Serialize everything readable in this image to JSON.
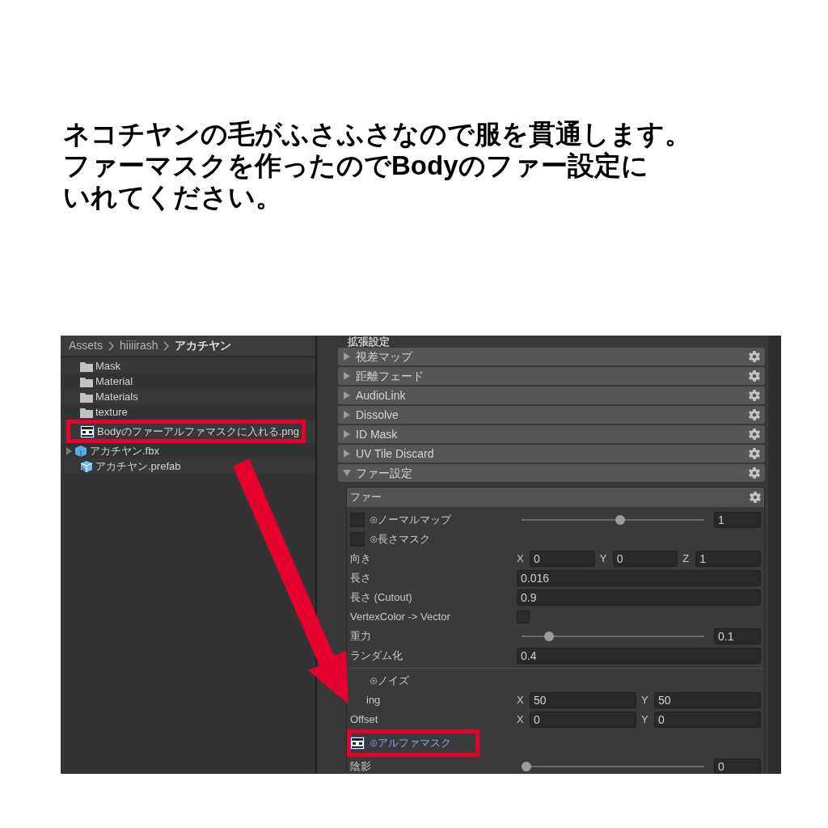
{
  "heading_lines": [
    "ネコチヤンの毛がふさふさなので服を貫通します。",
    "ファーマスクを作ったのでBodyのファー設定に",
    "いれてください。"
  ],
  "project": {
    "breadcrumb": [
      {
        "label": "Assets",
        "current": false
      },
      {
        "label": "hiiiirash",
        "current": false
      },
      {
        "label": "アカチヤン",
        "current": true
      }
    ],
    "items": [
      {
        "kind": "folder",
        "label": "Mask"
      },
      {
        "kind": "folder",
        "label": "Material"
      },
      {
        "kind": "folder",
        "label": "Materials"
      },
      {
        "kind": "folder",
        "label": "texture"
      },
      {
        "kind": "texture",
        "label": "Bodyのファーアルファマスクに入れる.png"
      },
      {
        "kind": "model",
        "label": "アカチヤン.fbx"
      },
      {
        "kind": "prefab",
        "label": "アカチヤン.prefab"
      }
    ]
  },
  "inspector": {
    "section_title": "拡張設定",
    "foldouts": [
      {
        "label": "視差マップ",
        "expanded": false
      },
      {
        "label": "距離フェード",
        "expanded": false
      },
      {
        "label": "AudioLink",
        "expanded": false
      },
      {
        "label": "Dissolve",
        "expanded": false
      },
      {
        "label": "ID Mask",
        "expanded": false
      },
      {
        "label": "UV Tile Discard",
        "expanded": false
      },
      {
        "label": "ファー設定",
        "expanded": true
      }
    ],
    "panel_title": "ファー",
    "rows": [
      {
        "kind": "texture",
        "label": "⊙ノーマルマップ",
        "assigned": false,
        "level": 0.54,
        "value": "1"
      },
      {
        "kind": "texture",
        "label": "⊙長さマスク",
        "assigned": false
      },
      {
        "kind": "vector3",
        "label": "向き",
        "axes": [
          "X",
          "Y",
          "Z"
        ],
        "values": [
          "0",
          "0",
          "1"
        ]
      },
      {
        "kind": "float",
        "label": "長さ",
        "value": "0.016"
      },
      {
        "kind": "float",
        "label": "長さ (Cutout)",
        "value": "0.9"
      },
      {
        "kind": "toggle",
        "label": "VertexColor -> Vector",
        "checked": false
      },
      {
        "kind": "slider",
        "label": "重力",
        "level": 0.13,
        "value": "0.1"
      },
      {
        "kind": "float",
        "label": "ランダム化",
        "value": "0.4"
      },
      {
        "kind": "divider"
      },
      {
        "kind": "texture_covered",
        "label": "⊙ノイズ"
      },
      {
        "kind": "vector2",
        "label": "ing",
        "axes": [
          "X",
          "Y"
        ],
        "values": [
          "50",
          "50"
        ]
      },
      {
        "kind": "vector2",
        "label": "Offset",
        "axes": [
          "X",
          "Y"
        ],
        "values": [
          "0",
          "0"
        ]
      },
      {
        "kind": "texture",
        "label": "⊙アルファマスク",
        "assigned": true
      },
      {
        "kind": "slider",
        "label": "陰影",
        "level": 0,
        "value": "0"
      }
    ]
  }
}
